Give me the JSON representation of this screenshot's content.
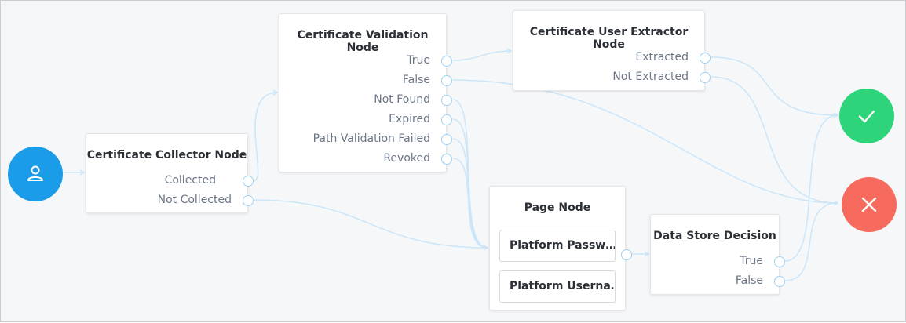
{
  "nodes": {
    "collector": {
      "title": "Certificate Collector Node",
      "outcomes": [
        "Collected",
        "Not Collected"
      ]
    },
    "validation": {
      "title": "Certificate Validation Node",
      "outcomes": [
        "True",
        "False",
        "Not Found",
        "Expired",
        "Path Validation Failed",
        "Revoked"
      ]
    },
    "extractor": {
      "title": "Certificate User Extractor Node",
      "outcomes": [
        "Extracted",
        "Not Extracted"
      ]
    },
    "page": {
      "title": "Page Node",
      "children": [
        "Platform Passw…",
        "Platform Userna…"
      ]
    },
    "datastore": {
      "title": "Data Store Decision",
      "outcomes": [
        "True",
        "False"
      ]
    }
  },
  "terminals": {
    "start": {
      "icon": "user-icon",
      "color": "#1a9ce8"
    },
    "success": {
      "icon": "check-icon",
      "color": "#2ed47a"
    },
    "failure": {
      "icon": "close-icon",
      "color": "#f66b5e"
    }
  }
}
